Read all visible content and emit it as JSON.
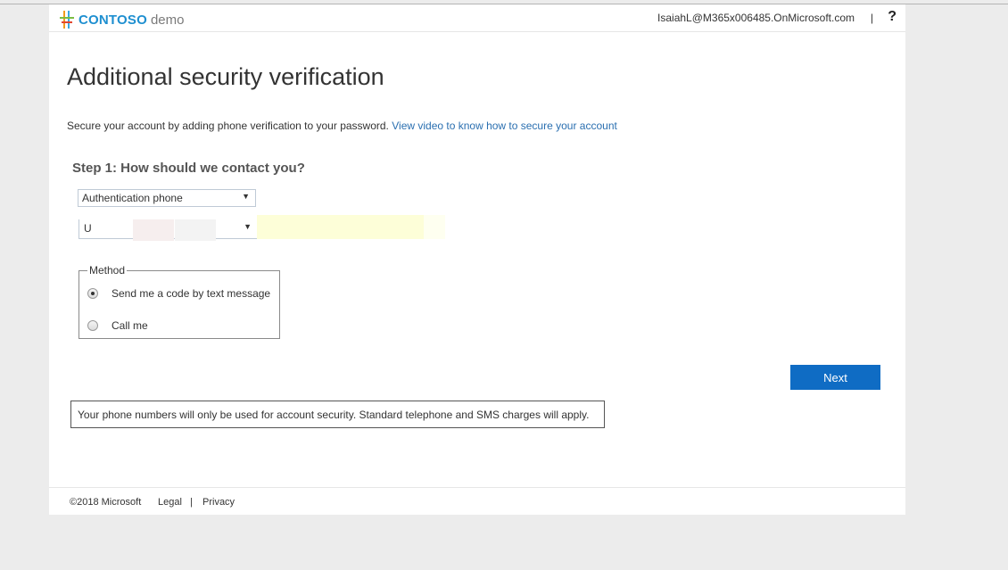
{
  "header": {
    "brand_name": "CONTOSO",
    "brand_suffix": "demo",
    "user_email": "IsaiahL@M365x006485.OnMicrosoft.com",
    "separator": "|",
    "help_glyph": "?"
  },
  "main": {
    "title": "Additional security verification",
    "intro_text": "Secure your account by adding phone verification to your password.",
    "intro_link": "View video to know how to secure your account",
    "step_title": "Step 1: How should we contact you?",
    "contact_method_selected": "Authentication phone",
    "country_selected": "U",
    "phone_value": "",
    "method": {
      "legend": "Method",
      "options": [
        {
          "label": "Send me a code by text message",
          "selected": true
        },
        {
          "label": "Call me",
          "selected": false
        }
      ]
    },
    "next_label": "Next",
    "notice": "Your phone numbers will only be used for account security. Standard telephone and SMS charges will apply."
  },
  "footer": {
    "copyright": "©2018 Microsoft",
    "legal": "Legal",
    "separator": "|",
    "privacy": "Privacy"
  },
  "colors": {
    "brand_blue": "#1e8fd0",
    "button_blue": "#0f6cc4",
    "link_blue": "#2a6fb0",
    "page_background": "#ececec"
  },
  "icons": {
    "logo": "contoso-logo-mark",
    "dropdown": "chevron-down-icon",
    "help": "help-icon"
  }
}
